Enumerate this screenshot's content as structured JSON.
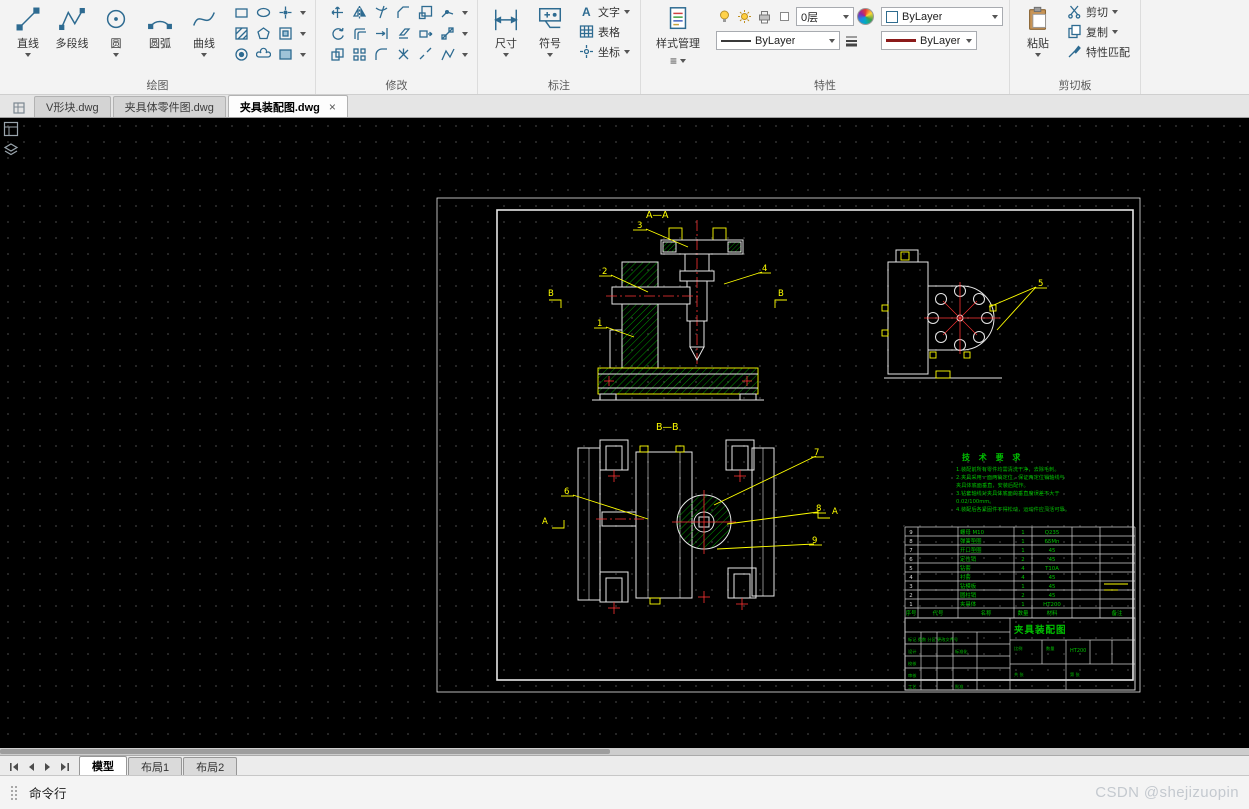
{
  "colors": {
    "canvas_bg": "#000000",
    "cad_white": "#e6e6e6",
    "cad_yellow": "#ffff00",
    "cad_red": "#ff3434",
    "cad_green": "#00c000",
    "ribbon_bg": "#f3f3f3"
  },
  "icons": {
    "close": "×",
    "list": "≡",
    "text_glyph": "A"
  },
  "ribbon": {
    "draw": {
      "label": "绘图",
      "tools": [
        "直线",
        "多段线",
        "圆",
        "圆弧",
        "曲线"
      ]
    },
    "modify": {
      "label": "修改"
    },
    "annotate": {
      "label": "标注",
      "dimension": "尺寸",
      "symbol": "符号",
      "text": "文字",
      "table": "表格",
      "coordinate": "坐标"
    },
    "props": {
      "label": "特性",
      "style": "样式管理",
      "layer": "0层",
      "color": "ByLayer",
      "linetype": "ByLayer",
      "lineweight": "ByLayer"
    },
    "clip": {
      "label": "剪切板",
      "paste": "粘贴",
      "cut": "剪切",
      "copy": "复制",
      "match": "特性匹配"
    }
  },
  "doc_tabs": [
    {
      "label": "V形块.dwg"
    },
    {
      "label": "夹具体零件图.dwg"
    },
    {
      "label": "夹具装配图.dwg",
      "active": true
    }
  ],
  "layout_tabs": [
    {
      "label": "模型"
    },
    {
      "label": "布局1"
    },
    {
      "label": "布局2"
    }
  ],
  "command_line": {
    "label": "命令行"
  },
  "watermark": "CSDN @shejizuopin",
  "drawing": {
    "labels": {
      "top_section": "A—A",
      "bottom_section": "B—B",
      "b_left": "B",
      "b_right": "B",
      "a_left": "A",
      "a_right": "A"
    },
    "balloons": [
      "1",
      "2",
      "3",
      "4",
      "5",
      "6",
      "7",
      "8",
      "9"
    ],
    "tech": {
      "title": "技 术 要 求",
      "lines": [
        "1.装配前所有零件均需清洗干净，去除毛刺。",
        "2.夹具采用一面两销定位，保证两定位销轴线与",
        "  夹具体底面垂直，安装后配作。",
        "3.钻套轴线对夹具体底面的垂直度误差不大于",
        "  0.02/100mm。",
        "4.装配后各紧固件不得松动，运动件应灵活可靠。"
      ]
    },
    "bom": {
      "header": [
        "序号",
        "代号",
        "名称",
        "数量",
        "材料",
        "备注"
      ],
      "rows": [
        {
          "no": "9",
          "name": "螺母 M10",
          "qty": "1",
          "mat": "Q235"
        },
        {
          "no": "8",
          "name": "弹簧垫圈",
          "qty": "1",
          "mat": "65Mn"
        },
        {
          "no": "7",
          "name": "开口垫圈",
          "qty": "1",
          "mat": "45"
        },
        {
          "no": "6",
          "name": "定位销",
          "qty": "2",
          "mat": "45"
        },
        {
          "no": "5",
          "name": "钻套",
          "qty": "4",
          "mat": "T10A"
        },
        {
          "no": "4",
          "name": "衬套",
          "qty": "4",
          "mat": "45"
        },
        {
          "no": "3",
          "name": "钻模板",
          "qty": "1",
          "mat": "45"
        },
        {
          "no": "2",
          "name": "圆柱销",
          "qty": "2",
          "mat": "45"
        },
        {
          "no": "1",
          "name": "夹具体",
          "qty": "1",
          "mat": "HT200"
        }
      ]
    },
    "title_block": {
      "title": "夹具装配图",
      "material": "HT200",
      "row_marks": "标记 处数 分区 更改文件号",
      "design": "设计",
      "check": "校核",
      "audit": "审核",
      "craft": "工艺",
      "std": "标准化",
      "approve": "批准",
      "scale": "比例",
      "qty": "数量",
      "sheets": "共 张",
      "sheet_no": "第 张"
    }
  }
}
